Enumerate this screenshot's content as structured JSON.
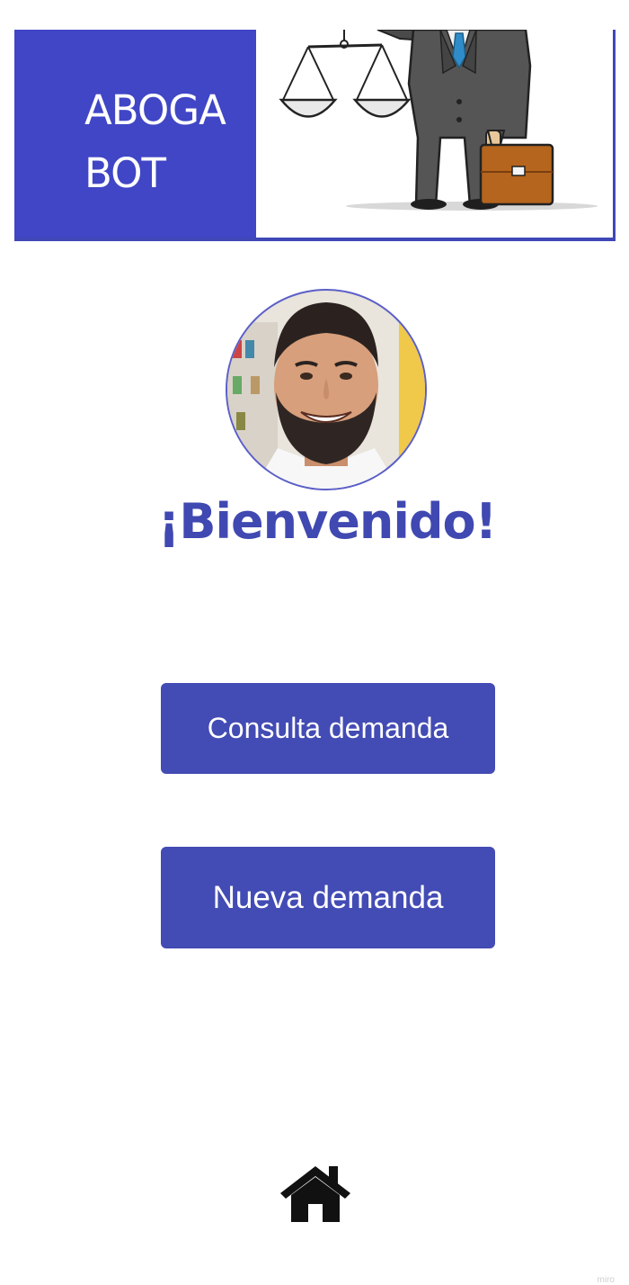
{
  "app": {
    "logo_lines": [
      "ABOGA",
      "BOT"
    ],
    "brand_color": "#4046c5"
  },
  "header": {
    "logo_icon": "lawyer-with-scales-illustration"
  },
  "profile": {
    "avatar_icon": "user-photo"
  },
  "main": {
    "welcome_text": "¡Bienvenido!",
    "buttons": {
      "consulta_label": "Consulta demanda",
      "nueva_label": "Nueva demanda"
    }
  },
  "footer": {
    "home_icon": "home-icon",
    "watermark": "miro"
  }
}
